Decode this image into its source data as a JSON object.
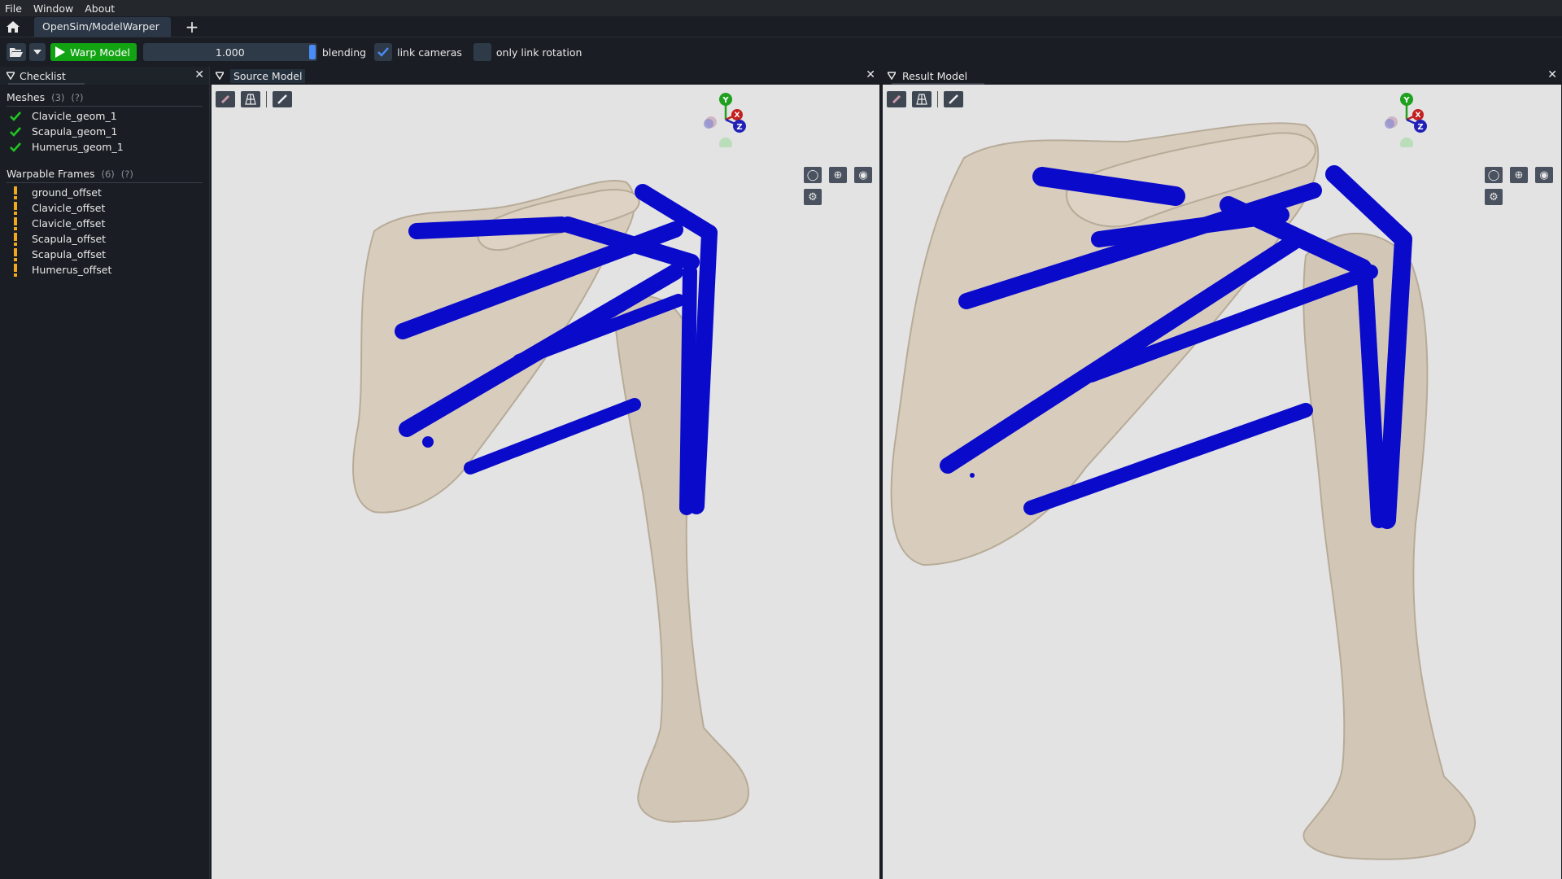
{
  "menu": [
    "File",
    "Window",
    "About"
  ],
  "tab": {
    "label": "OpenSim/ModelWarper",
    "add_icon": "+"
  },
  "toolbar": {
    "warp_label": "Warp Model",
    "blend_value": "1.000",
    "blending_label": "blending",
    "link_cameras_label": "link cameras",
    "link_cameras_checked": true,
    "only_link_rotation_label": "only link rotation",
    "only_link_rotation_checked": false
  },
  "checklist": {
    "title": "Checklist",
    "meshes": {
      "label": "Meshes",
      "count": "(3)",
      "help": "(?)",
      "items": [
        "Clavicle_geom_1",
        "Scapula_geom_1",
        "Humerus_geom_1"
      ]
    },
    "frames": {
      "label": "Warpable Frames",
      "count": "(6)",
      "help": "(?)",
      "items": [
        "ground_offset",
        "Clavicle_offset",
        "Clavicle_offset",
        "Scapula_offset",
        "Scapula_offset",
        "Humerus_offset"
      ]
    }
  },
  "source_viewport": {
    "title": "Source Model"
  },
  "result_viewport": {
    "title": "Result Model"
  },
  "axes": {
    "y": "Y",
    "x": "X",
    "z": "Z"
  },
  "colors": {
    "ok": "#22c422",
    "warn": "#f2a81d",
    "accent": "#4a8cf5",
    "bone": "#d8cdbd",
    "frame": "#0a0acb",
    "warp_green": "#12a312"
  }
}
